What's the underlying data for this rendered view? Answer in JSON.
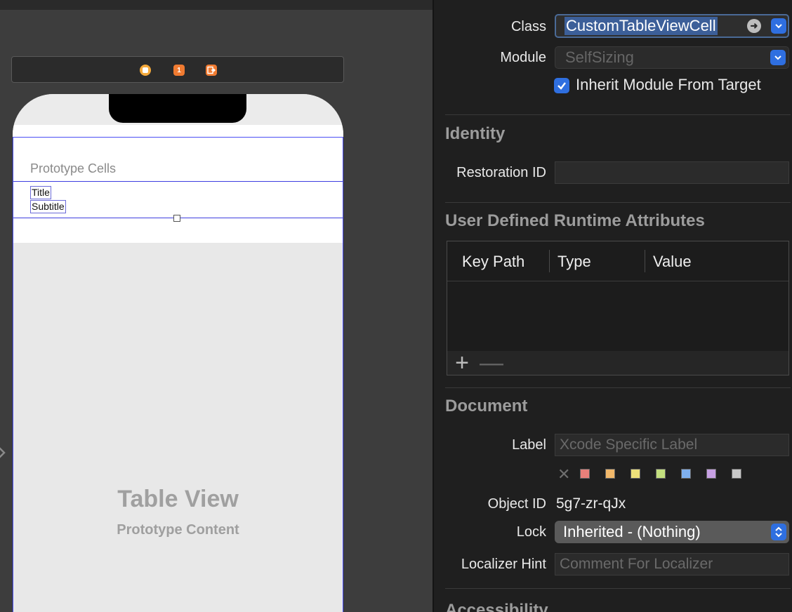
{
  "canvas": {
    "table_section_header": "Prototype Cells",
    "cell": {
      "title": "Title",
      "subtitle": "Subtitle"
    },
    "placeholder": {
      "title": "Table View",
      "subtitle": "Prototype Content"
    },
    "dock_icons": [
      "view-controller-icon",
      "first-responder-icon",
      "exit-icon"
    ],
    "first_responder_badge": "1"
  },
  "inspector": {
    "custom_class": {
      "class_label": "Class",
      "class_value": "CustomTableViewCell",
      "module_label": "Module",
      "module_placeholder": "SelfSizing",
      "inherit_label": "Inherit Module From Target",
      "inherit_checked": true
    },
    "identity": {
      "title": "Identity",
      "restoration_id_label": "Restoration ID",
      "restoration_id_value": ""
    },
    "runtime_attributes": {
      "title": "User Defined Runtime Attributes",
      "columns": [
        "Key Path",
        "Type",
        "Value"
      ],
      "rows": [],
      "add_glyph": "+",
      "remove_glyph": "—"
    },
    "document": {
      "title": "Document",
      "label_label": "Label",
      "label_placeholder": "Xcode Specific Label",
      "no_color_glyph": "✕",
      "colors": [
        "#e8807a",
        "#f1b86a",
        "#eee17a",
        "#c3df7e",
        "#7fb0ef",
        "#c7a0e4",
        "#c8c8c8"
      ],
      "object_id_label": "Object ID",
      "object_id_value": "5g7-zr-qJx",
      "lock_label": "Lock",
      "lock_value": "Inherited - (Nothing)",
      "localizer_label": "Localizer Hint",
      "localizer_placeholder": "Comment For Localizer"
    },
    "accessibility": {
      "title": "Accessibility"
    }
  },
  "colors": {
    "accent": "#2f6fe0",
    "selection_outline": "#4b4ef5"
  }
}
